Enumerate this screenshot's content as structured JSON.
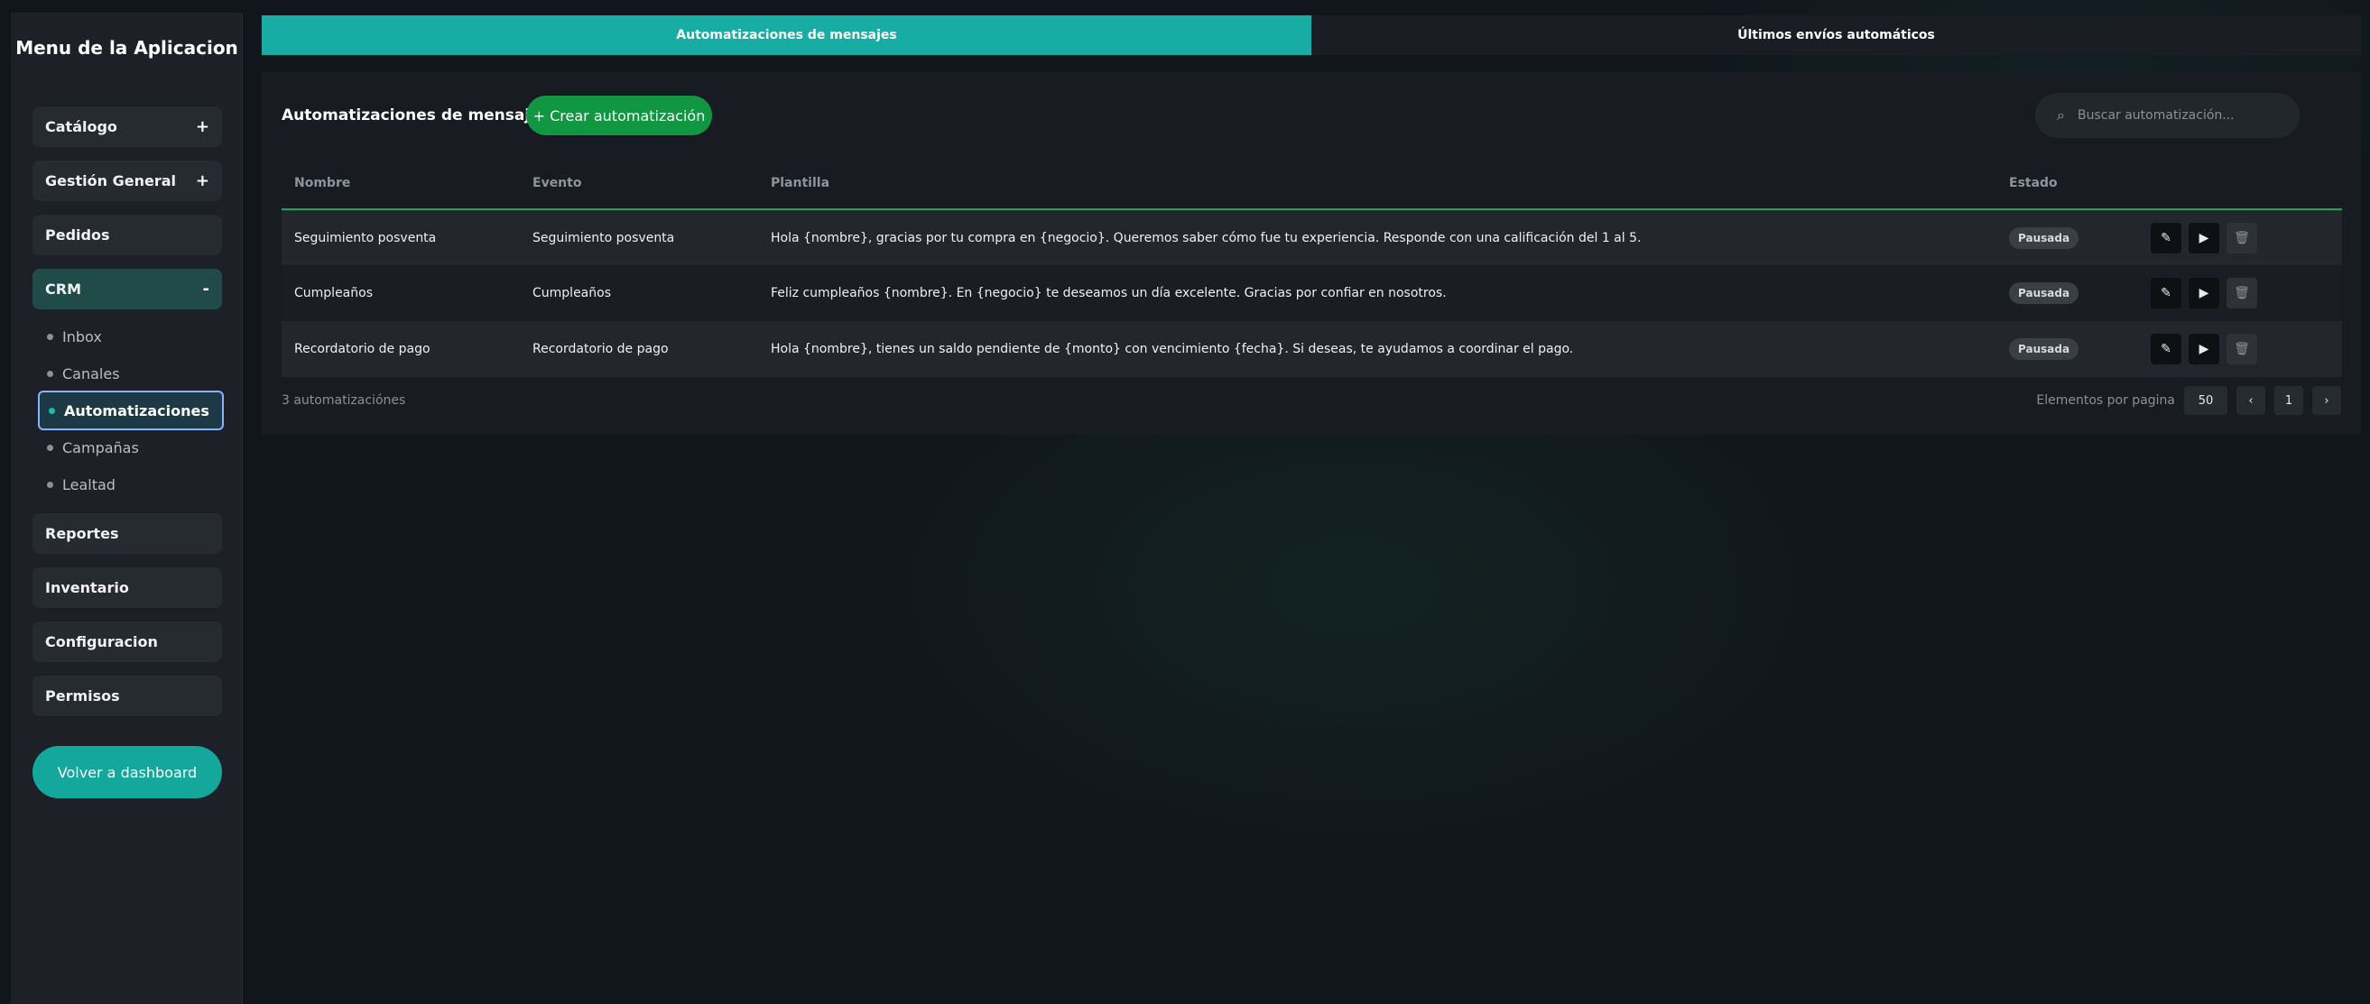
{
  "sidebar": {
    "title": "Menu de la Aplicacion",
    "sections": [
      {
        "label": "Catálogo",
        "toggle": "+"
      },
      {
        "label": "Gestión General",
        "toggle": "+"
      },
      {
        "label": "Pedidos",
        "toggle": ""
      },
      {
        "label": "CRM",
        "toggle": "-"
      }
    ],
    "crm_items": [
      {
        "label": "Inbox"
      },
      {
        "label": "Canales"
      },
      {
        "label": "Automatizaciones"
      },
      {
        "label": "Campañas"
      },
      {
        "label": "Lealtad"
      }
    ],
    "bottom_sections": [
      {
        "label": "Reportes"
      },
      {
        "label": "Inventario"
      },
      {
        "label": "Configuracion"
      },
      {
        "label": "Permisos"
      }
    ],
    "back_button": "Volver a dashboard"
  },
  "tabs": [
    {
      "label": "Automatizaciones de mensajes",
      "active": true
    },
    {
      "label": "Últimos envíos automáticos",
      "active": false
    }
  ],
  "main": {
    "title": "Automatizaciones de mensajes",
    "create_button": "+ Crear automatización",
    "search_placeholder": "Buscar automatización...",
    "search_icon": "search-icon",
    "columns": [
      "Nombre",
      "Evento",
      "Plantilla",
      "Estado"
    ],
    "rows": [
      {
        "nombre": "Seguimiento posventa",
        "evento": "Seguimiento posventa",
        "plantilla": "Hola {nombre}, gracias por tu compra en {negocio}. Queremos saber cómo fue tu experiencia. Responde con una calificación del 1 al 5.",
        "estado": "Pausada",
        "actions": {
          "edit": "✎",
          "play": "▶",
          "delete": "🗑"
        }
      },
      {
        "nombre": "Cumpleaños",
        "evento": "Cumpleaños",
        "plantilla": "Feliz cumpleaños {nombre}. En {negocio} te deseamos un día excelente. Gracias por confiar en nosotros.",
        "estado": "Pausada",
        "actions": {
          "edit": "✎",
          "play": "▶",
          "delete": "🗑"
        }
      },
      {
        "nombre": "Recordatorio de pago",
        "evento": "Recordatorio de pago",
        "plantilla": "Hola {nombre}, tienes un saldo pendiente de {monto} con vencimiento {fecha}. Si deseas, te ayudamos a coordinar el pago.",
        "estado": "Pausada",
        "actions": {
          "edit": "✎",
          "play": "▶",
          "delete": "🗑"
        }
      }
    ],
    "count_text": "3 automatizaciónes",
    "pagination": {
      "label": "Elementos por pagina",
      "page_size": "50",
      "prev": "‹",
      "page": "1",
      "next": "›"
    }
  },
  "colors": {
    "accent_teal": "#17ada5",
    "create_green": "#119742",
    "header_border_green": "#1aa457",
    "crm_active_bg": "#204b48"
  }
}
